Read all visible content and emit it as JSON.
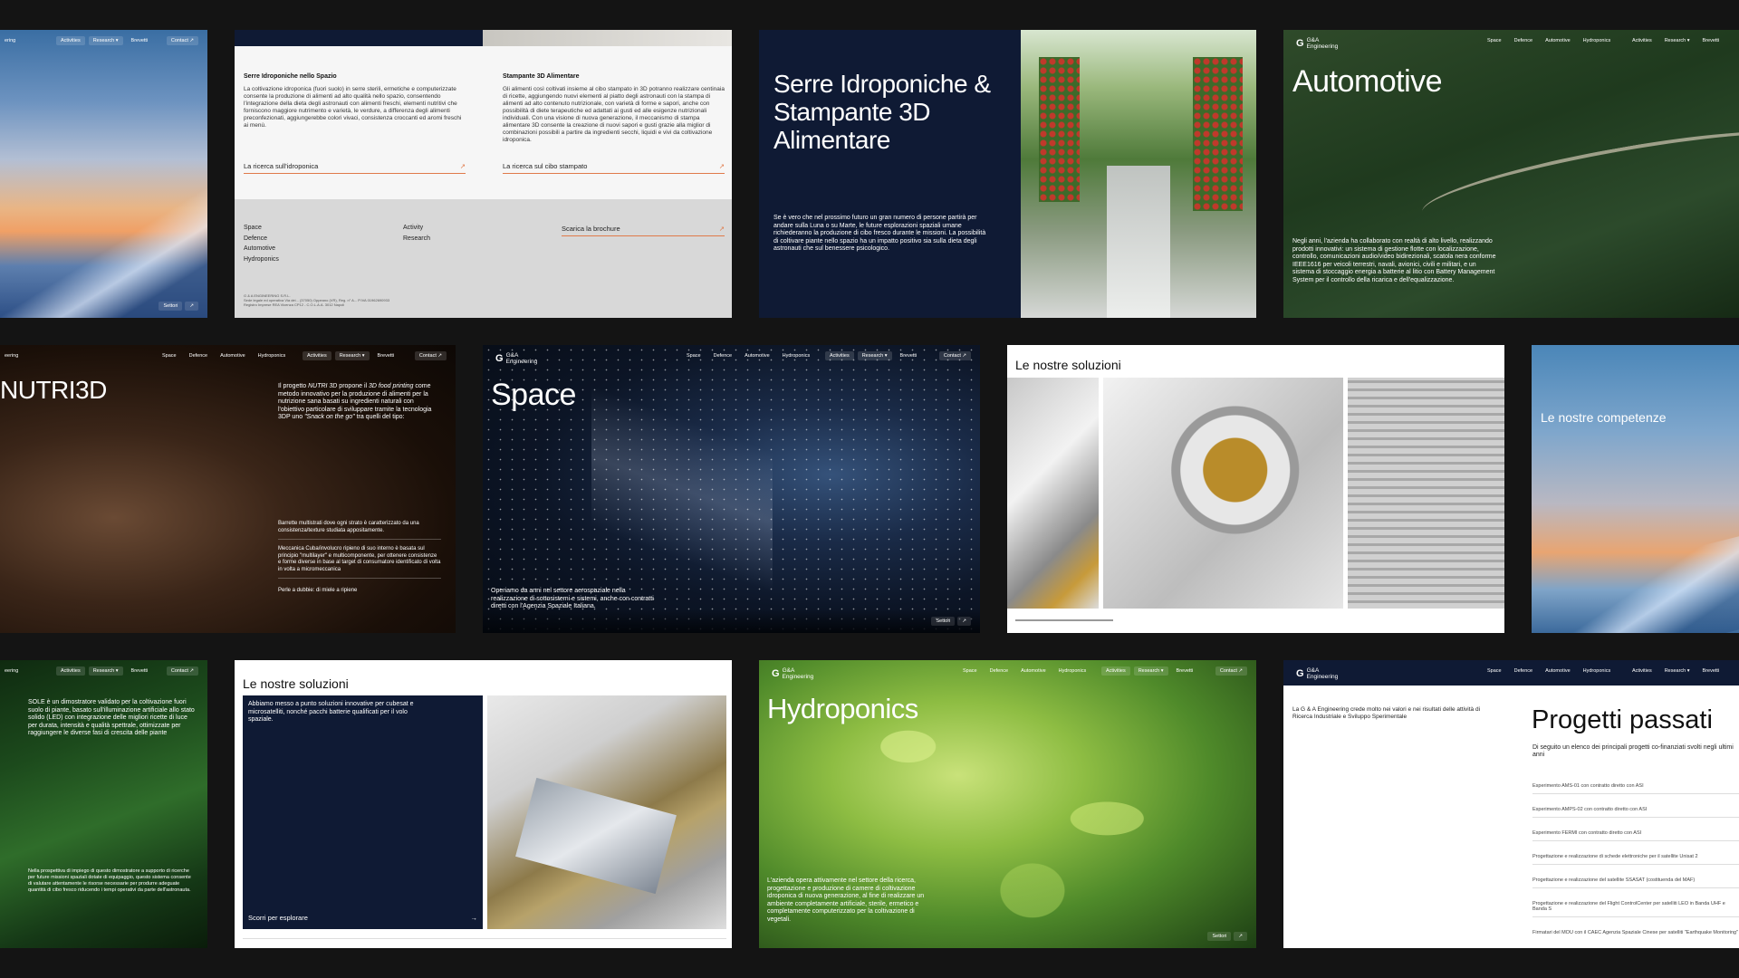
{
  "tiles": {
    "sunset": {
      "nav": {
        "logo": "ering",
        "activities": "Activities",
        "research": "Research ▾",
        "brevetti": "Brevetti",
        "contact": "Contact ↗"
      },
      "footer": {
        "settori": "Settori",
        "arrow": "↗"
      }
    },
    "serre_text": {
      "col1": {
        "title": "Serre Idroponiche nello Spazio",
        "body": "La coltivazione idroponica (fuori suolo) in serre sterili, ermetiche e computerizzate consente la produzione di alimenti ad alto qualità nello spazio, consentendo l'integrazione della dieta degli astronauti con alimenti freschi, elementi nutritivi che forniscono maggiore nutrimento e varietà, le verdure, a differenza degli alimenti preconfezionati, aggiungerebbe colori vivaci, consistenza croccanti ed aromi freschi ai menù.",
        "link": "La ricerca sull'idroponica"
      },
      "col2": {
        "title": "Stampante 3D Alimentare",
        "body": "Gli alimenti così coltivati insieme al cibo stampato in 3D potranno realizzare centinaia di ricette, aggiungendo nuovi elementi al piatto degli astronauti con la stampa di alimenti ad alto contenuto nutrizionale, con varietà di forme e sapori, anche con possibilità di diete terapeutiche ed adattati ai gusti ed alle esigenze nutrizionali individuali. Con una visione di nuova generazione, il meccanismo di stampa alimentare 3D consente la creazione di nuovi sapori e gusti grazie alla miglior di combinazioni possibili a partire da ingredienti secchi, liquidi e vivi da coltivazione idroponica.",
        "link": "La ricerca sul cibo stampato"
      },
      "footer": {
        "links_a": [
          "Space",
          "Defence",
          "Automotive",
          "Hydroponics"
        ],
        "links_b": [
          "Activity",
          "Research"
        ],
        "brochure": "Scarica la brochure",
        "legal1": "G & A ENGINEERING S.R.L.",
        "legal2": "Sede legale ed operativa Via dei... (37050) Oppeano (VR), Reg. n° A... P.IVA 01962690933",
        "legal3": "Registro Imprese REA Vicenza CP12 - C.O.L.A.A. 3012 Napoli"
      }
    },
    "serre_hero": {
      "title": "Serre Idroponiche & Stampante 3D Alimentare",
      "body": "Se è vero che nel prossimo futuro un gran numero di persone partirà per andare sulla Luna o su Marte, le future esplorazioni spaziali umane richiederanno la produzione di cibo fresco durante le missioni. La possibilità di coltivare piante nello spazio ha un impatto positivo sia sulla dieta degli astronauti che sul benessere psicologico."
    },
    "automotive": {
      "nav": {
        "logo_a": "G&A",
        "logo_b": "Engineering",
        "space": "Space",
        "defence": "Defence",
        "automotive": "Automotive",
        "hydroponics": "Hydroponics",
        "activities": "Activities",
        "research": "Research ▾",
        "brevetti": "Brevetti"
      },
      "title": "Automotive",
      "body": "Negli anni, l'azienda ha collaborato con realtà di alto livello, realizzando prodotti innovativi: un sistema di gestione flotte con localizzazione, controllo, comunicazioni audio/video bidirezionali, scatola nera conforme IEEE1616 per veicoli terrestri, navali, avionici, civili e militari, e un sistema di stoccaggio energia a batterie al litio con Battery Management System per il controllo della ricarica e dell'equalizzazione."
    },
    "nutri": {
      "nav": {
        "logo": "eering",
        "space": "Space",
        "defence": "Defence",
        "automotive": "Automotive",
        "hydroponics": "Hydroponics",
        "activities": "Activities",
        "research": "Research ▾",
        "brevetti": "Brevetti",
        "contact": "Contact ↗"
      },
      "title": "NUTRI3D",
      "intro_a": "Il progetto ",
      "intro_b": "NUTRI 3D",
      "intro_c": " propone il ",
      "intro_d": "3D food printing",
      "intro_e": " come metodo innovativo per la produzione di alimenti per la nutrizione sana basati su ingredienti naturali con l'obiettivo particolare di sviluppare tramite la tecnologia 3DP uno ",
      "intro_f": "\"Snack on the go\"",
      "intro_g": " tra quelli del tipo:",
      "item1": "Barrette multistrati dove ogni strato è caratterizzato da una consistenza/texture studiata appositamente.",
      "item2": "Meccanica Cuba/involucro ripieno di suo interno è basata sul principio \"multilayer\" e multicomponente, per ottenere consistenze e forme diverse in base al target di consumatore identificato di volta in volta a micromeccanica",
      "item3": "Perle a dubbie: di miele a ripiene"
    },
    "space": {
      "nav": {
        "logo_a": "G&A",
        "logo_b": "Engineering",
        "space": "Space",
        "defence": "Defence",
        "automotive": "Automotive",
        "hydroponics": "Hydroponics",
        "activities": "Activities",
        "research": "Research ▾",
        "brevetti": "Brevetti",
        "contact": "Contact ↗"
      },
      "title": "Space",
      "body": "Operiamo da anni nel settore aerospaziale nella realizzazione di sottosistemi e sistemi, anche con contratti diretti con l'Agenzia Spaziale Italiana.",
      "footer": {
        "settori": "Settori",
        "arrow": "↗"
      }
    },
    "soluzioni1": {
      "title": "Le nostre soluzioni"
    },
    "competenze": {
      "title": "Le nostre competenze"
    },
    "sole": {
      "nav": {
        "logo": "eering",
        "activities": "Activities",
        "research": "Research ▾",
        "brevetti": "Brevetti",
        "contact": "Contact ↗"
      },
      "body1": "SOLE è un dimostratore validato per la coltivazione fuori suolo di piante, basato sull'illuminazione artificiale allo stato solido (LED) con integrazione delle migliori ricette di luce per durata, intensità e qualità spettrale, ottimizzate per raggiungere le diverse fasi di crescita delle piante",
      "body2": "Nella prospettiva di impiego di questo dimostratore a supporto di ricerche per future missioni spaziali dotate di equipaggio, questo sistema consente di valutare attentamente le risorse necessarie per produrre adeguate quantità di cibo fresco riducendo i tempi operativi da parte dell'astronauta."
    },
    "soluzioni2": {
      "title": "Le nostre soluzioni",
      "card_body": "Abbiamo messo a punto soluzioni innovative per cubesat e microsatelliti, nonché pacchi batterie qualificati per il volo spaziale.",
      "card_link": "Scorri per esplorare"
    },
    "hydro": {
      "nav": {
        "logo_a": "G&A",
        "logo_b": "Engineering",
        "space": "Space",
        "defence": "Defence",
        "automotive": "Automotive",
        "hydroponics": "Hydroponics",
        "activities": "Activities",
        "research": "Research ▾",
        "brevetti": "Brevetti",
        "contact": "Contact ↗"
      },
      "title": "Hydroponics",
      "body": "L'azienda opera attivamente nel settore della ricerca, progettazione e produzione di camere di coltivazione idroponica di nuova generazione, al fine di realizzare un ambiente completamente artificiale, sterile, ermetico e completamente computerizzato per la coltivazione di vegetali.",
      "footer": {
        "settori": "Settori",
        "arrow": "↗"
      }
    },
    "progetti": {
      "nav": {
        "logo_a": "G&A",
        "logo_b": "Engineering",
        "space": "Space",
        "defence": "Defence",
        "automotive": "Automotive",
        "hydroponics": "Hydroponics",
        "activities": "Activities",
        "research": "Research ▾",
        "brevetti": "Brevetti"
      },
      "intro": "La G & A Engineering crede molto nei valori e nei risultati delle attività di Ricerca Industriale e Sviluppo Sperimentale",
      "title": "Progetti passati",
      "subtitle": "Di seguito un elenco dei principali progetti co-finanziati svolti negli ultimi anni",
      "items": [
        "Esperimento AMS-01 con contratto diretto con ASI",
        "Esperimento AMPS-02 con contratto diretto con ASI",
        "Esperimento FERMI con contratto diretto con ASI",
        "Progettazione e realizzazione di schede elettroniche per il satellite Unisat 2",
        "Progettazione e realizzazione del satellite SSASAT (costituenda del MAF)",
        "Progettazione e realizzazione del Flight ControlCenter per satelliti LEO in Banda UHF e Banda S",
        "Firmatari del MOU con il CAEC Agenzia Spaziale Cinese per satelliti \"Earthquake Monitoring\""
      ]
    }
  },
  "colors": {
    "navy": "#0f1a34",
    "orange": "#e07a4a",
    "bg": "#141414"
  }
}
